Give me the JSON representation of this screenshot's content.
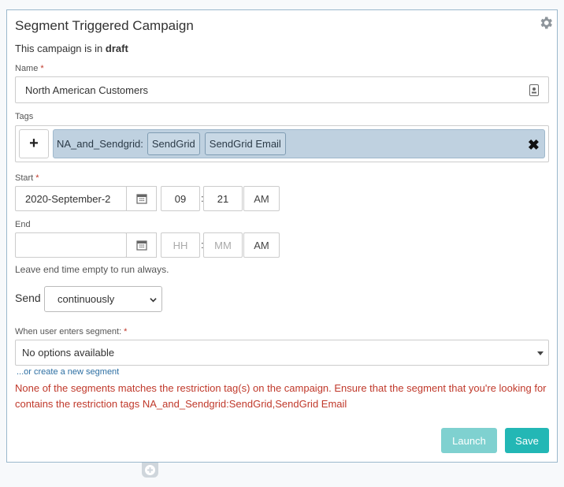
{
  "campaign": {
    "title": "Segment Triggered Campaign",
    "status_prefix": "This campaign is in",
    "status_value": "draft"
  },
  "fields": {
    "name_label": "Name",
    "name_value": "North American Customers",
    "tags_label": "Tags",
    "start_label": "Start",
    "end_label": "End",
    "required_mark": "*"
  },
  "tags": {
    "add_symbol": "+",
    "group_name": "NA_and_Sendgrid:",
    "items": [
      "SendGrid",
      "SendGrid Email"
    ],
    "remove_symbol": "✖"
  },
  "start": {
    "date": "2020-September-2",
    "hour": "09",
    "minute": "21",
    "ampm": "AM"
  },
  "end": {
    "date": "",
    "hour_placeholder": "HH",
    "minute_placeholder": "MM",
    "ampm": "AM"
  },
  "time_separator": ":",
  "end_hint": "Leave end time empty to run always.",
  "send": {
    "label": "Send",
    "selected": "continuously"
  },
  "segment": {
    "label": "When user enters segment:",
    "selected": "No options available",
    "create_link": "...or create a new segment",
    "error": "None of the segments matches the restriction tag(s) on the campaign. Ensure that the segment that you're looking for contains the restriction tags NA_and_Sendgrid:SendGrid,SendGrid Email"
  },
  "buttons": {
    "launch": "Launch",
    "save": "Save"
  },
  "icons": {
    "settings": "gear-icon",
    "contact": "contact-card-icon",
    "calendar": "calendar-icon",
    "dropdown": "chevron-down-icon",
    "add_block": "plus-icon"
  },
  "colors": {
    "accent": "#23b7b5",
    "accent_disabled": "#7fd1d0",
    "error": "#c0392b",
    "tag_bg": "#bfd1e0",
    "link": "#2d6fa3"
  }
}
